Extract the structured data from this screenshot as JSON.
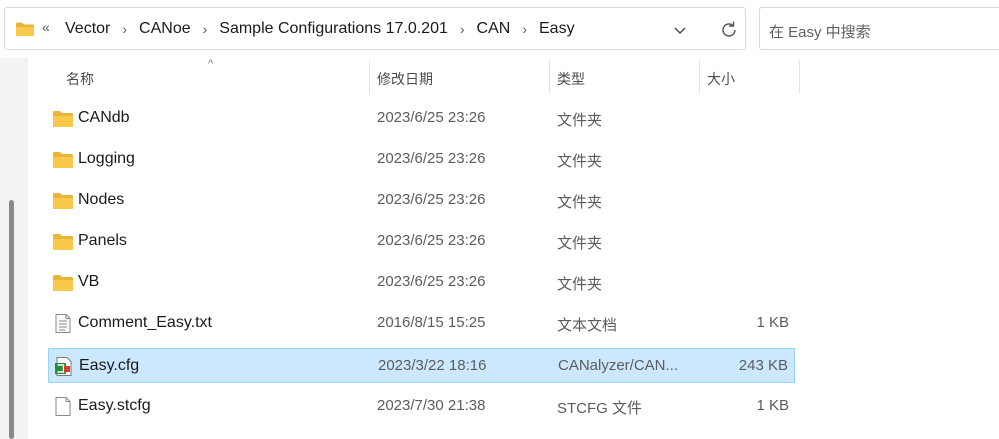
{
  "address_bar": {
    "overflow_marker": "«",
    "crumbs": [
      "Vector",
      "CANoe",
      "Sample Configurations 17.0.201",
      "CAN",
      "Easy"
    ],
    "separator": "›"
  },
  "search": {
    "placeholder": "在 Easy 中搜索"
  },
  "columns": {
    "name": "名称",
    "modified": "修改日期",
    "type": "类型",
    "size": "大小"
  },
  "files": [
    {
      "name": "CANdb",
      "modified": "2023/6/25 23:26",
      "type": "文件夹",
      "size": "",
      "icon": "folder-icon",
      "selected": false
    },
    {
      "name": "Logging",
      "modified": "2023/6/25 23:26",
      "type": "文件夹",
      "size": "",
      "icon": "folder-icon",
      "selected": false
    },
    {
      "name": "Nodes",
      "modified": "2023/6/25 23:26",
      "type": "文件夹",
      "size": "",
      "icon": "folder-icon",
      "selected": false
    },
    {
      "name": "Panels",
      "modified": "2023/6/25 23:26",
      "type": "文件夹",
      "size": "",
      "icon": "folder-icon",
      "selected": false
    },
    {
      "name": "VB",
      "modified": "2023/6/25 23:26",
      "type": "文件夹",
      "size": "",
      "icon": "folder-icon",
      "selected": false
    },
    {
      "name": "Comment_Easy.txt",
      "modified": "2016/8/15 15:25",
      "type": "文本文档",
      "size": "1 KB",
      "icon": "text-file-icon",
      "selected": false
    },
    {
      "name": "Easy.cfg",
      "modified": "2023/3/22 18:16",
      "type": "CANalyzer/CAN...",
      "size": "243 KB",
      "icon": "canoe-config-icon",
      "selected": true
    },
    {
      "name": "Easy.stcfg",
      "modified": "2023/7/30 21:38",
      "type": "STCFG 文件",
      "size": "1 KB",
      "icon": "blank-file-icon",
      "selected": false
    }
  ],
  "colors": {
    "selection_bg": "#cce8ff",
    "selection_border": "#99d1ff",
    "folder": "#f8c94a"
  }
}
